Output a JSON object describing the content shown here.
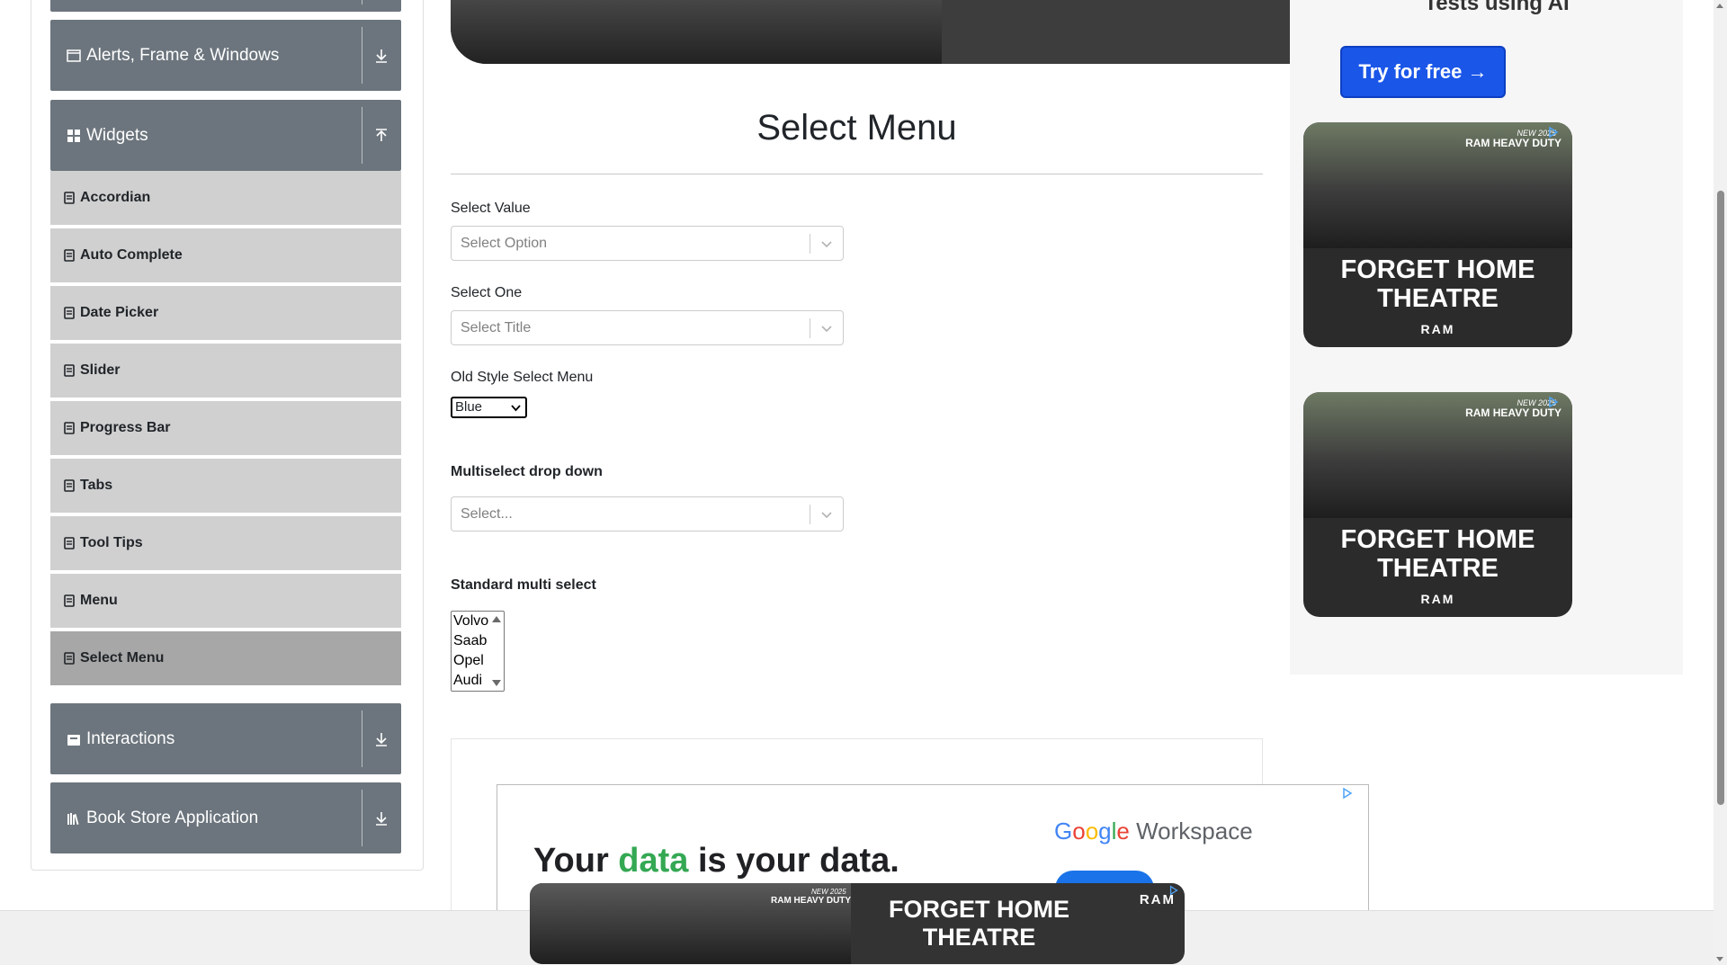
{
  "sidebar": {
    "groups": {
      "alerts": {
        "label": "Alerts, Frame & Windows",
        "icon": "window-icon",
        "arrow": "download-arrow-icon"
      },
      "widgets": {
        "label": "Widgets",
        "icon": "grid-icon",
        "arrow": "upload-arrow-icon"
      },
      "interactions": {
        "label": "Interactions",
        "icon": "interactions-icon",
        "arrow": "download-arrow-icon"
      },
      "bookstore": {
        "label": "Book Store Application",
        "icon": "books-icon",
        "arrow": "download-arrow-icon"
      }
    },
    "widget_items": [
      {
        "label": "Accordian"
      },
      {
        "label": "Auto Complete"
      },
      {
        "label": "Date Picker"
      },
      {
        "label": "Slider"
      },
      {
        "label": "Progress Bar"
      },
      {
        "label": "Tabs"
      },
      {
        "label": "Tool Tips"
      },
      {
        "label": "Menu"
      },
      {
        "label": "Select Menu",
        "active": true
      }
    ]
  },
  "main": {
    "title": "Select Menu",
    "select_value": {
      "label": "Select Value",
      "placeholder": "Select Option"
    },
    "select_one": {
      "label": "Select One",
      "placeholder": "Select Title"
    },
    "old_style": {
      "label": "Old Style Select Menu",
      "selected": "Blue"
    },
    "multiselect": {
      "label": "Multiselect drop down",
      "placeholder": "Select..."
    },
    "standard_multi": {
      "label": "Standard multi select",
      "options": [
        "Volvo",
        "Saab",
        "Opel",
        "Audi"
      ]
    }
  },
  "ads": {
    "ai_text": "Tests using AI",
    "try_button": "Try for free →",
    "ram": {
      "brand": "RAM HEAVY DUTY",
      "newtag": "NEW 2025",
      "headline_line1": "FORGET HOME",
      "headline_line2": "THEATRE",
      "logo": "RAM"
    },
    "google": {
      "headline_part1": "Your ",
      "headline_green": "data",
      "headline_part2": " is your data.",
      "brand_g1": "G",
      "brand_g2": "o",
      "brand_g3": "o",
      "brand_g4": "g",
      "brand_g5": "l",
      "brand_g6": "e",
      "brand_rest": " Workspace"
    }
  },
  "colors": {
    "sidebar_header": "#6c757d",
    "menu_item": "#d0d0d0",
    "menu_item_active": "#a7a7a7",
    "try_button": "#1a56e8"
  }
}
